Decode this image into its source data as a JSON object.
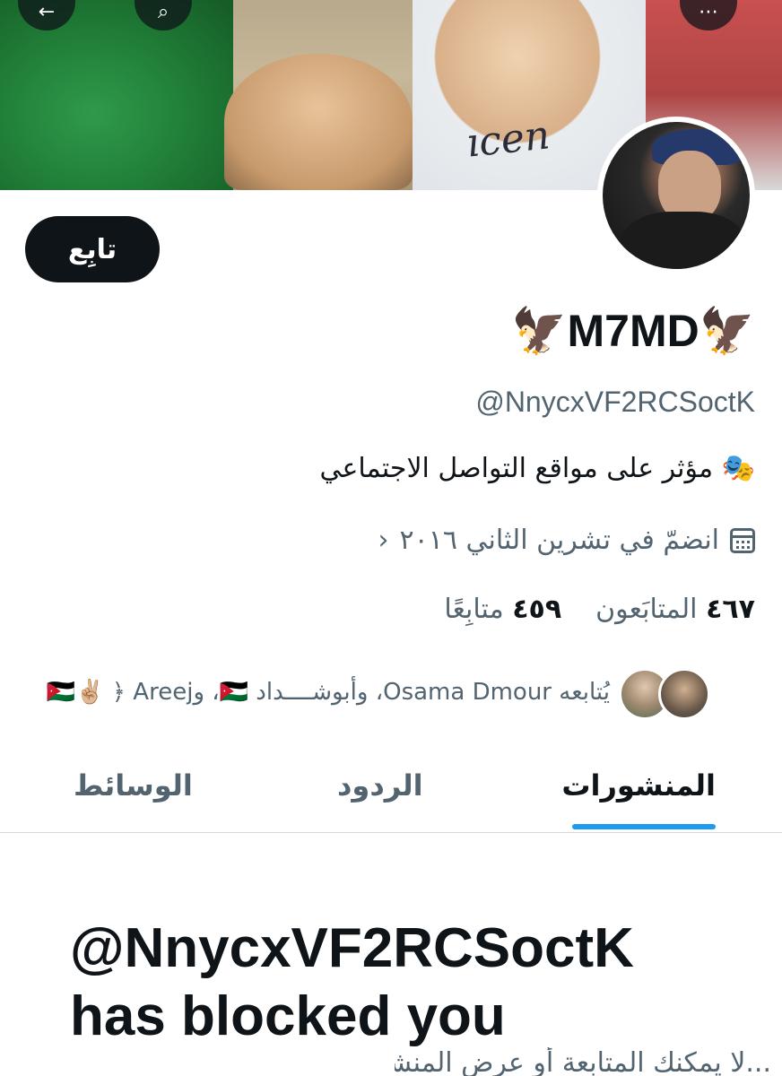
{
  "profile": {
    "follow_label": "تابِع",
    "display_name": "🦅M7MD🦅",
    "handle": "@NnycxVF2RCSoctK",
    "bio": "🎭 مؤثر على مواقع التواصل الاجتماعي",
    "joined": "انضمّ في تشرين الثاني ٢٠١٦",
    "followers_count": "٤٦٧",
    "followers_label": "المتابَعون",
    "following_count": "٤٥٩",
    "following_label": "متابِعًا",
    "followed_by": "يُتابعه Osama Dmour، وأبوشــــداد 🇯🇴، و🇯🇴✌🏼 ﴿ Areej"
  },
  "tabs": [
    {
      "label": "المنشورات",
      "active": true
    },
    {
      "label": "الردود",
      "active": false
    },
    {
      "label": "الوسائط",
      "active": false
    }
  ],
  "blocked": {
    "handle": "@NnycxVF2RCSoctK",
    "message": "has blocked you",
    "sub_text": "...لا يمكنك المتابعة أو عرض المنشورات"
  },
  "icons": {
    "calendar": "calendar-icon",
    "chevron": "chevron-left-icon"
  },
  "colors": {
    "primary_text": "#0f1419",
    "secondary_text": "#536471",
    "accent": "#1d9bf0",
    "button_bg": "#0f1419"
  }
}
